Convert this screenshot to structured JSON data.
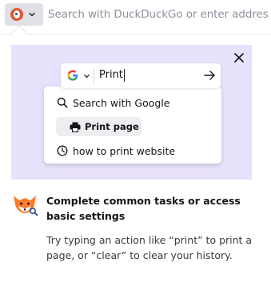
{
  "urlbar": {
    "engine_icon": "duckduckgo-icon",
    "chevron_icon": "chevron-down-icon",
    "placeholder": "Search with DuckDuckGo or enter address",
    "value": ""
  },
  "panel": {
    "close_icon": "close-icon",
    "illustration": {
      "search_engine_icon": "google-icon",
      "typed_text": "Print",
      "go_icon": "arrow-right-icon",
      "suggestions": [
        {
          "icon": "search-icon",
          "label": "Search with Google"
        },
        {
          "icon": "printer-icon",
          "label": "Print page"
        },
        {
          "icon": "history-icon",
          "label": "how to print website"
        }
      ]
    },
    "mascot_icon": "fox-icon",
    "title": "Complete common tasks or access basic settings",
    "body": "Try typing an action like “print” to print a page, or “clear” to clear your history."
  },
  "colors": {
    "illustration_bg": "#e8e1fb",
    "engine_button_bg": "#e0e0e6",
    "ddg_orange": "#de5833",
    "fox_orange": "#ff7a2b"
  }
}
